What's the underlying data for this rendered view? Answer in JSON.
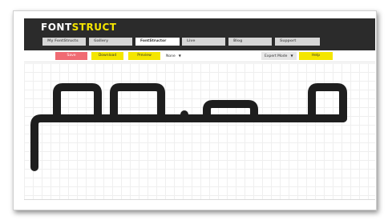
{
  "app": {
    "logo_part1": "FONT",
    "logo_part2": "STRUCT"
  },
  "tabs": [
    {
      "label": "My FontStructs"
    },
    {
      "label": "Gallery"
    },
    {
      "label": "FontStructor"
    },
    {
      "label": "Live"
    },
    {
      "label": "Blog"
    },
    {
      "label": "Support"
    }
  ],
  "active_tab": "FontStructor",
  "toolbar": {
    "save_label": "Save",
    "download_label": "Download",
    "preview_label": "Preview",
    "font_select_value": "None",
    "mode_select_value": "Expert Mode",
    "help_label": "Help"
  },
  "colors": {
    "header_bg": "#2b2b2b",
    "logo_accent": "#f6e600",
    "save_button": "#f06b73",
    "action_button": "#f4e600",
    "glyph": "#1e1e1e"
  }
}
